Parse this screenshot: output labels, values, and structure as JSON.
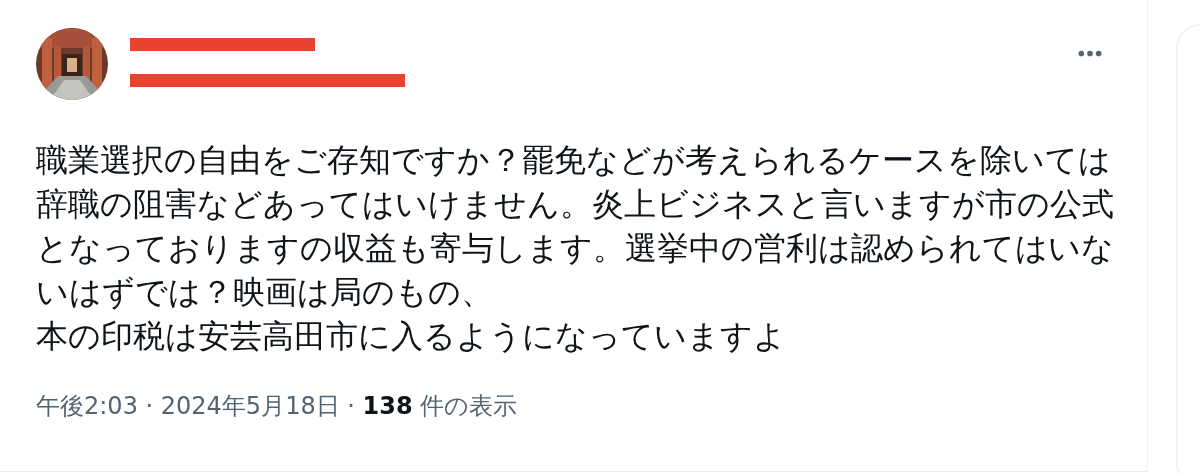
{
  "tweet": {
    "author": {
      "name_redacted": true,
      "handle_redacted": true
    },
    "lines": [
      "職業選択の自由をご存知ですか？罷免などが考えられるケースを除いては",
      "辞職の阻害などあってはいけません。炎上ビジネスと言いますが市の公式",
      "となっておりますの収益も寄与します。選挙中の営利は認められてはいな",
      "いはずでは？映画は局のもの、",
      "本の印税は安芸高田市に入るようになっていますよ"
    ],
    "timestamp": "午後2:03 · 2024年5月18日 · ",
    "view_count": "138",
    "views_label": "件の表示"
  }
}
